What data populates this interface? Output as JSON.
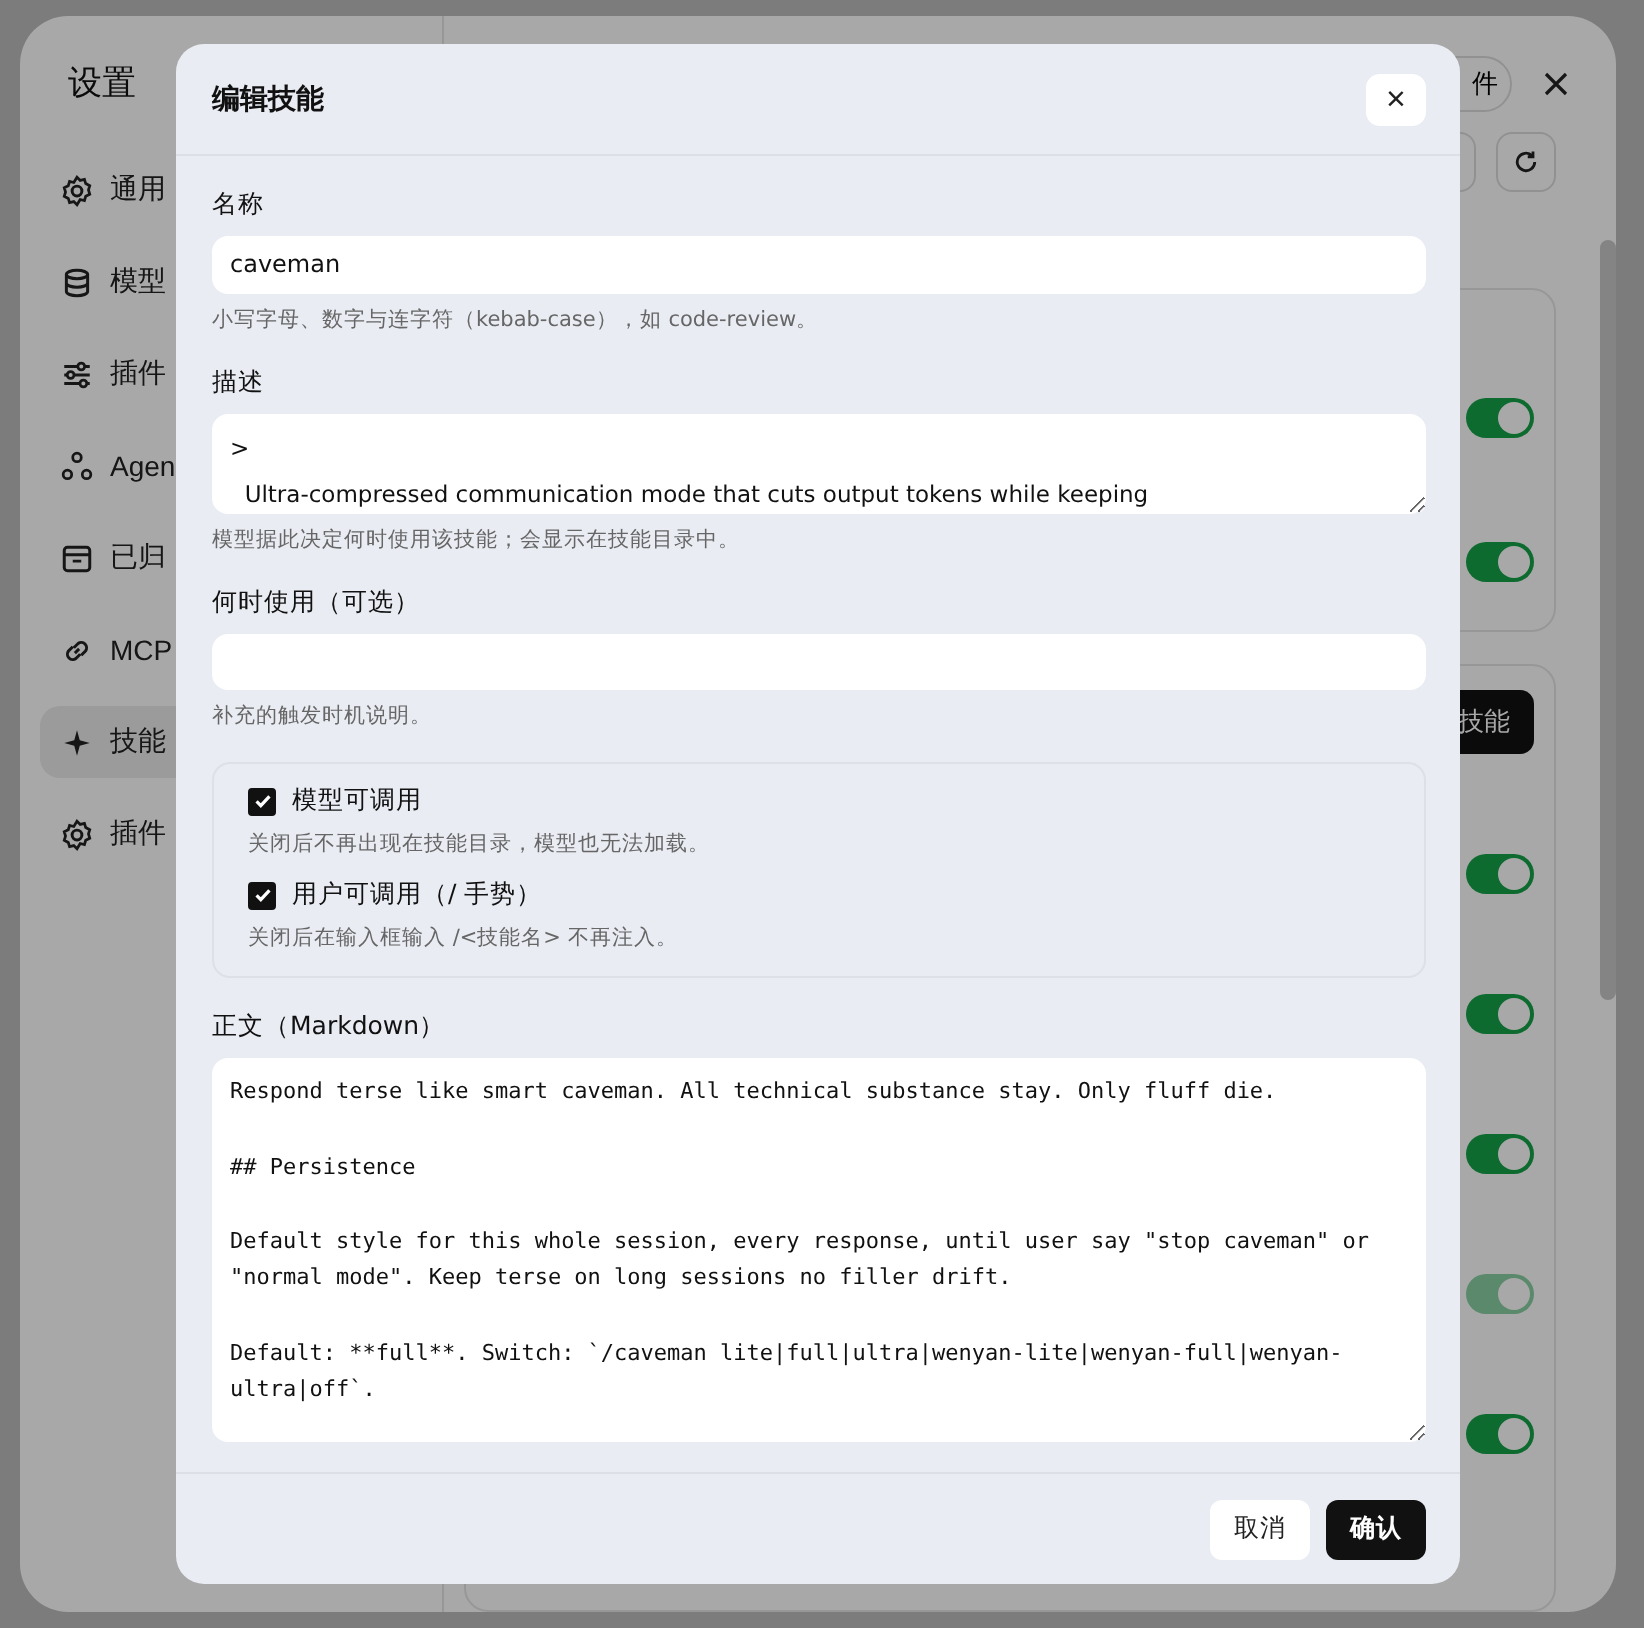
{
  "settings": {
    "title": "设置",
    "header_button": "件",
    "add_button": "技能",
    "sidebar": [
      {
        "label": "通用",
        "selected": false
      },
      {
        "label": "模型",
        "selected": false
      },
      {
        "label": "插件",
        "selected": false
      },
      {
        "label": "Agen",
        "selected": false
      },
      {
        "label": "已归",
        "selected": false
      },
      {
        "label": "MCP",
        "selected": false
      },
      {
        "label": "技能",
        "selected": true
      },
      {
        "label": "插件",
        "selected": false
      }
    ],
    "toggles": [
      {
        "on": true,
        "disabled": false
      },
      {
        "on": true,
        "disabled": false
      },
      {
        "on": true,
        "disabled": false
      },
      {
        "on": true,
        "disabled": false
      },
      {
        "on": true,
        "disabled": false
      },
      {
        "on": true,
        "disabled": true
      },
      {
        "on": true,
        "disabled": false
      }
    ]
  },
  "dialog": {
    "title": "编辑技能",
    "close": "×",
    "name": {
      "label": "名称",
      "value": "caveman",
      "hint": "小写字母、数字与连字符（kebab-case），如 code-review。"
    },
    "description": {
      "label": "描述",
      "value": ">\n  Ultra-compressed communication mode that cuts output tokens while keeping",
      "hint": "模型据此决定何时使用该技能；会显示在技能目录中。"
    },
    "when": {
      "label": "何时使用（可选）",
      "hint": "补充的触发时机说明。"
    },
    "options": [
      {
        "label": "模型可调用",
        "checked": true,
        "hint": "关闭后不再出现在技能目录，模型也无法加载。"
      },
      {
        "label": "用户可调用（/ 手势）",
        "checked": true,
        "hint": "关闭后在输入框输入 /<技能名> 不再注入。"
      }
    ],
    "body": {
      "label": "正文（Markdown）",
      "value": "Respond terse like smart caveman. All technical substance stay. Only fluff die.\n\n## Persistence\n\nDefault style for this whole session, every response, until user say \"stop caveman\" or \"normal mode\". Keep terse on long sessions no filler drift.\n\nDefault: **full**. Switch: `/caveman lite|full|ultra|wenyan-lite|wenyan-full|wenyan-ultra|off`."
    },
    "buttons": [
      {
        "label": "取消",
        "kind": "secondary"
      },
      {
        "label": "确认",
        "kind": "primary"
      }
    ]
  }
}
